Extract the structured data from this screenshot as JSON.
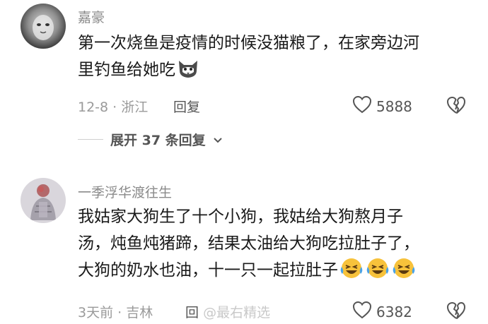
{
  "comments": [
    {
      "username": "嘉豪",
      "lines": [
        "第一次烧鱼是疫情的时候没猫粮了，在家旁边河",
        "里钓鱼给她吃"
      ],
      "emoji": "cat-face-emoji",
      "time_location": "12-8 · 浙江",
      "reply_label": "回复",
      "likes": "5888",
      "expand_label": "展开 37 条回复"
    },
    {
      "username": "一季浮华渡往生",
      "lines": [
        "我姑家大狗生了十个小狗，我姑给大狗熬月子",
        "汤，炖鱼炖猪蹄，结果太油给大狗吃拉肚子了，",
        "大狗的奶水也油，十一只一起拉肚子"
      ],
      "emoji": "laughing-crying-emoji",
      "time_location": "3天前 · 吉林",
      "reply_label": "回",
      "watermark": "@最右精选",
      "likes": "6382"
    }
  ],
  "colors": {
    "username": "#8a8a8a",
    "text": "#1a1a1a",
    "meta": "#9a9a9a",
    "emoji_yellow": "#f7c23b",
    "emoji_tear": "#4aa3e8"
  },
  "icons": [
    "heart-outline-icon",
    "broken-heart-icon",
    "chevron-down-icon"
  ]
}
